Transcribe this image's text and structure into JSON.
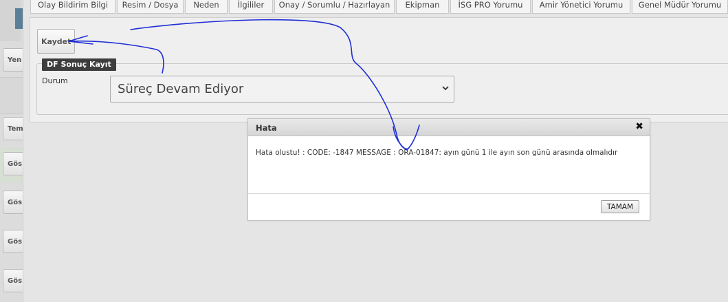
{
  "tabs": [
    {
      "label": "Olay Bildirim Bilgi"
    },
    {
      "label": "Resim / Dosya"
    },
    {
      "label": "Neden"
    },
    {
      "label": "İlgililer"
    },
    {
      "label": "Onay / Sorumlu / Hazırlayan"
    },
    {
      "label": "Ekipman"
    },
    {
      "label": "İSG PRO Yorumu"
    },
    {
      "label": "Amir Yönetici Yorumu"
    },
    {
      "label": "Genel Müdür Yorumu"
    }
  ],
  "left_buttons": [
    "Yen",
    "Tem",
    "Gös",
    "Gös",
    "Gös",
    "Gös"
  ],
  "form": {
    "save_label": "Kaydet",
    "section_title": "DF Sonuç Kayıt",
    "durum_label": "Durum",
    "durum_value": "Süreç Devam Ediyor"
  },
  "modal": {
    "title": "Hata",
    "close_icon": "✖",
    "message": "Hata olustu! : CODE: -1847 MESSAGE : ORA-01847: ayın günü 1 ile ayın son günü arasında olmalıdır",
    "ok_label": "TAMAM"
  },
  "colors": {
    "annotation_ink": "#1f2fd6",
    "legend_bg": "#3d3d3d"
  }
}
